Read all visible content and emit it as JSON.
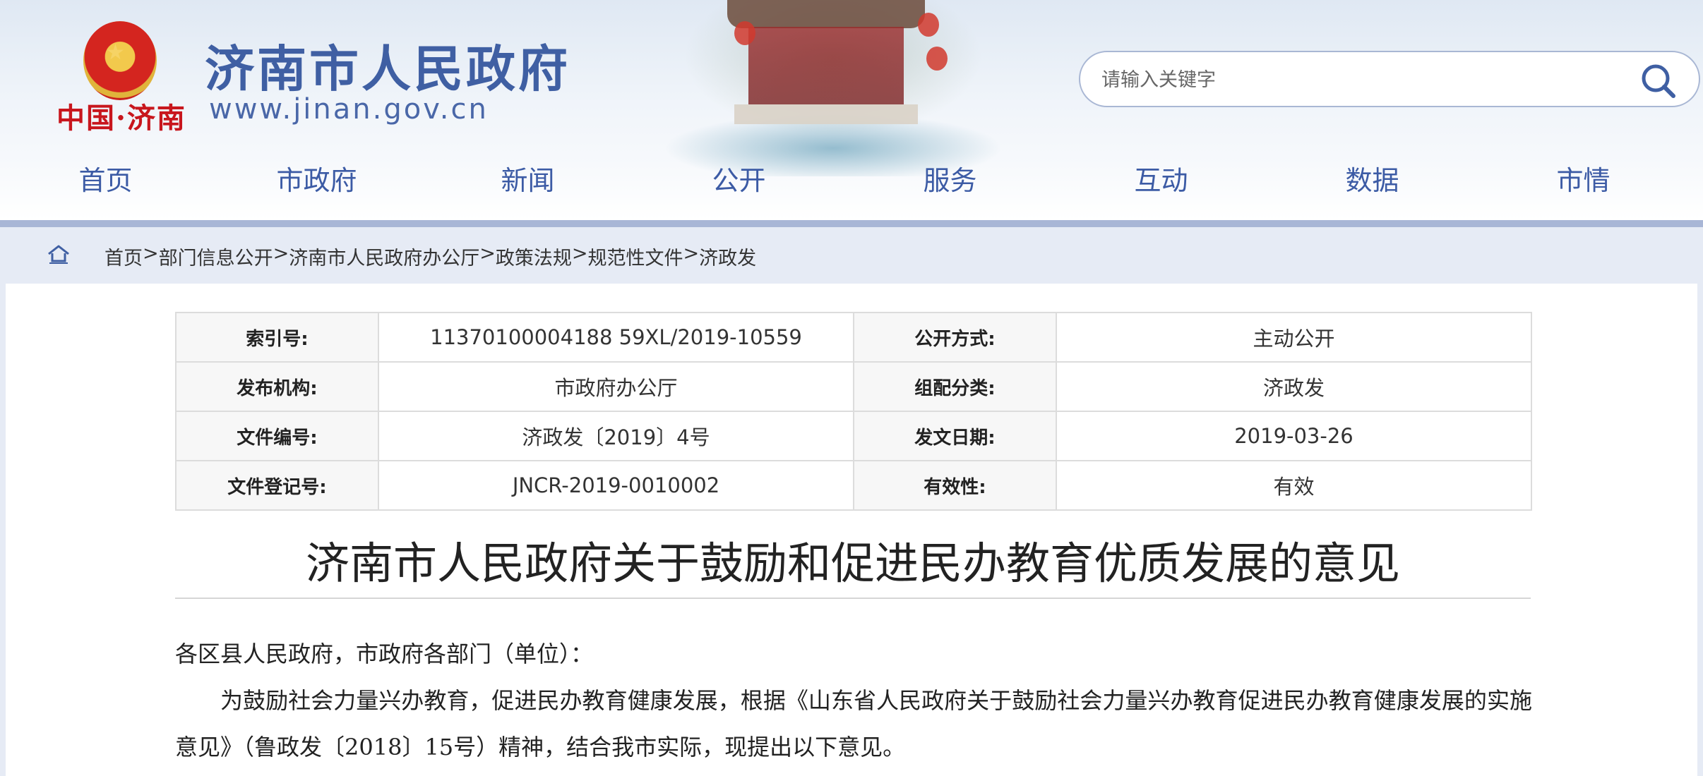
{
  "header": {
    "site_title": "济南市人民政府",
    "site_url": "www.jinan.gov.cn",
    "city_mark": "中国·济南",
    "search": {
      "placeholder": "请输入关键字"
    }
  },
  "nav": {
    "items": [
      {
        "label": "首页"
      },
      {
        "label": "市政府"
      },
      {
        "label": "新闻"
      },
      {
        "label": "公开"
      },
      {
        "label": "服务"
      },
      {
        "label": "互动"
      },
      {
        "label": "数据"
      },
      {
        "label": "市情"
      }
    ]
  },
  "breadcrumb": {
    "items": [
      {
        "label": "首页"
      },
      {
        "label": "部门信息公开"
      },
      {
        "label": "济南市人民政府办公厅"
      },
      {
        "label": "政策法规"
      },
      {
        "label": "规范性文件"
      },
      {
        "label": "济政发"
      }
    ],
    "separator": ">"
  },
  "meta": {
    "rows": [
      {
        "label1": "索引号:",
        "value1": "11370100004188 59XL/2019-10559",
        "label2": "公开方式:",
        "value2": "主动公开"
      },
      {
        "label1": "发布机构:",
        "value1": "市政府办公厅",
        "label2": "组配分类:",
        "value2": "济政发"
      },
      {
        "label1": "文件编号:",
        "value1": "济政发〔2019〕4号",
        "label2": "发文日期:",
        "value2": "2019-03-26"
      },
      {
        "label1": "文件登记号:",
        "value1": "JNCR-2019-0010002",
        "label2": "有效性:",
        "value2": "有效"
      }
    ]
  },
  "document": {
    "title": "济南市人民政府关于鼓励和促进民办教育优质发展的意见",
    "salutation": "各区县人民政府，市政府各部门（单位）：",
    "paragraph1": "为鼓励社会力量兴办教育，促进民办教育健康发展，根据《山东省人民政府关于鼓励社会力量兴办教育促进民办教育健康发展的实施意见》（鲁政发〔2018〕15号）精神，结合我市实际，现提出以下意见。"
  },
  "icons": {
    "search": "search-icon",
    "home": "home-icon",
    "emblem": "national-emblem-icon"
  },
  "colors": {
    "brand_blue": "#3f5fa3",
    "nav_text": "#3c5ba5",
    "header_bar": "#a8b6d6",
    "crumb_bg": "#e6ebf5",
    "emblem_red": "#d4251f",
    "city_mark_red": "#c8161d"
  }
}
